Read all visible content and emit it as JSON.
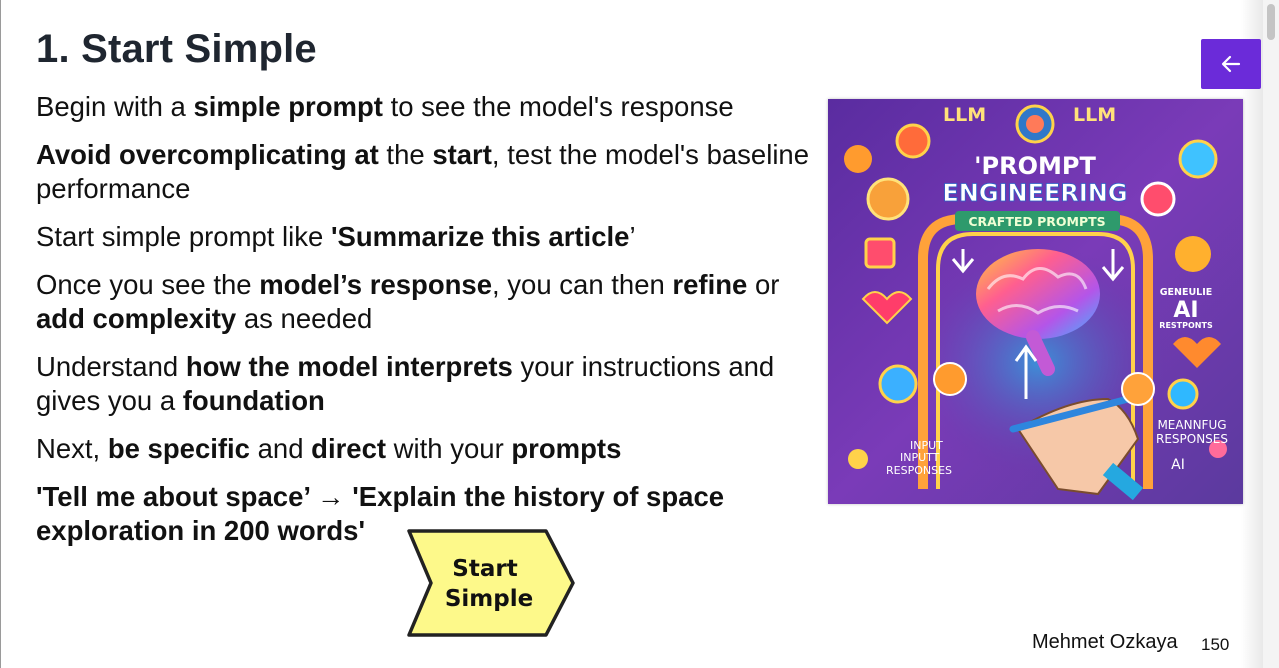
{
  "slide": {
    "title": "1. Start Simple",
    "bullets": [
      [
        {
          "t": "Begin with a "
        },
        {
          "t": "simple prompt",
          "b": true
        },
        {
          "t": " to see the model's response"
        }
      ],
      [
        {
          "t": "Avoid overcomplicating at",
          "b": true
        },
        {
          "t": " the "
        },
        {
          "t": "start",
          "b": true
        },
        {
          "t": ", test the model's baseline performance"
        }
      ],
      [
        {
          "t": "Start simple prompt like "
        },
        {
          "t": "'Summarize this article",
          "b": true
        },
        {
          "t": "’"
        }
      ],
      [
        {
          "t": "Once you see the "
        },
        {
          "t": "model’s response",
          "b": true
        },
        {
          "t": ", you can then "
        },
        {
          "t": "refine",
          "b": true
        },
        {
          "t": " or "
        },
        {
          "t": "add complexity",
          "b": true
        },
        {
          "t": " as needed"
        }
      ],
      [
        {
          "t": "Understand "
        },
        {
          "t": "how the model interprets",
          "b": true
        },
        {
          "t": " your instructions and gives you a "
        },
        {
          "t": "foundation",
          "b": true
        }
      ],
      [
        {
          "t": "Next, "
        },
        {
          "t": "be specific",
          "b": true
        },
        {
          "t": " and "
        },
        {
          "t": "direct",
          "b": true
        },
        {
          "t": " with your "
        },
        {
          "t": "prompts",
          "b": true
        }
      ],
      [
        {
          "t": "'Tell me about space’ → 'Explain the history of space exploration in 200 words'",
          "b": true
        }
      ]
    ],
    "callout": {
      "line1": "Start",
      "line2": "Simple",
      "fill": "#fdf98a",
      "stroke": "#222222"
    },
    "author": "Mehmet Ozkaya",
    "page_number": "150",
    "back_button_icon": "arrow-left-icon",
    "accent_color": "#6b2bd9"
  },
  "illustration": {
    "top_left": "LLM",
    "top_right": "LLM",
    "heading1": "'PROMPT",
    "heading2": "ENGINEERING",
    "banner": "CRAFTED   PROMPTS",
    "right_small1": "GENEULIE",
    "right_big": "AI",
    "right_small2": "RESTPONTS",
    "bottom_left1": "INPUT",
    "bottom_left2": "INPUTT",
    "bottom_left3": "RESPONSES",
    "bottom_right1": "MEANNFUG",
    "bottom_right2": "RESPONSES",
    "bottom_right3": "AI"
  }
}
